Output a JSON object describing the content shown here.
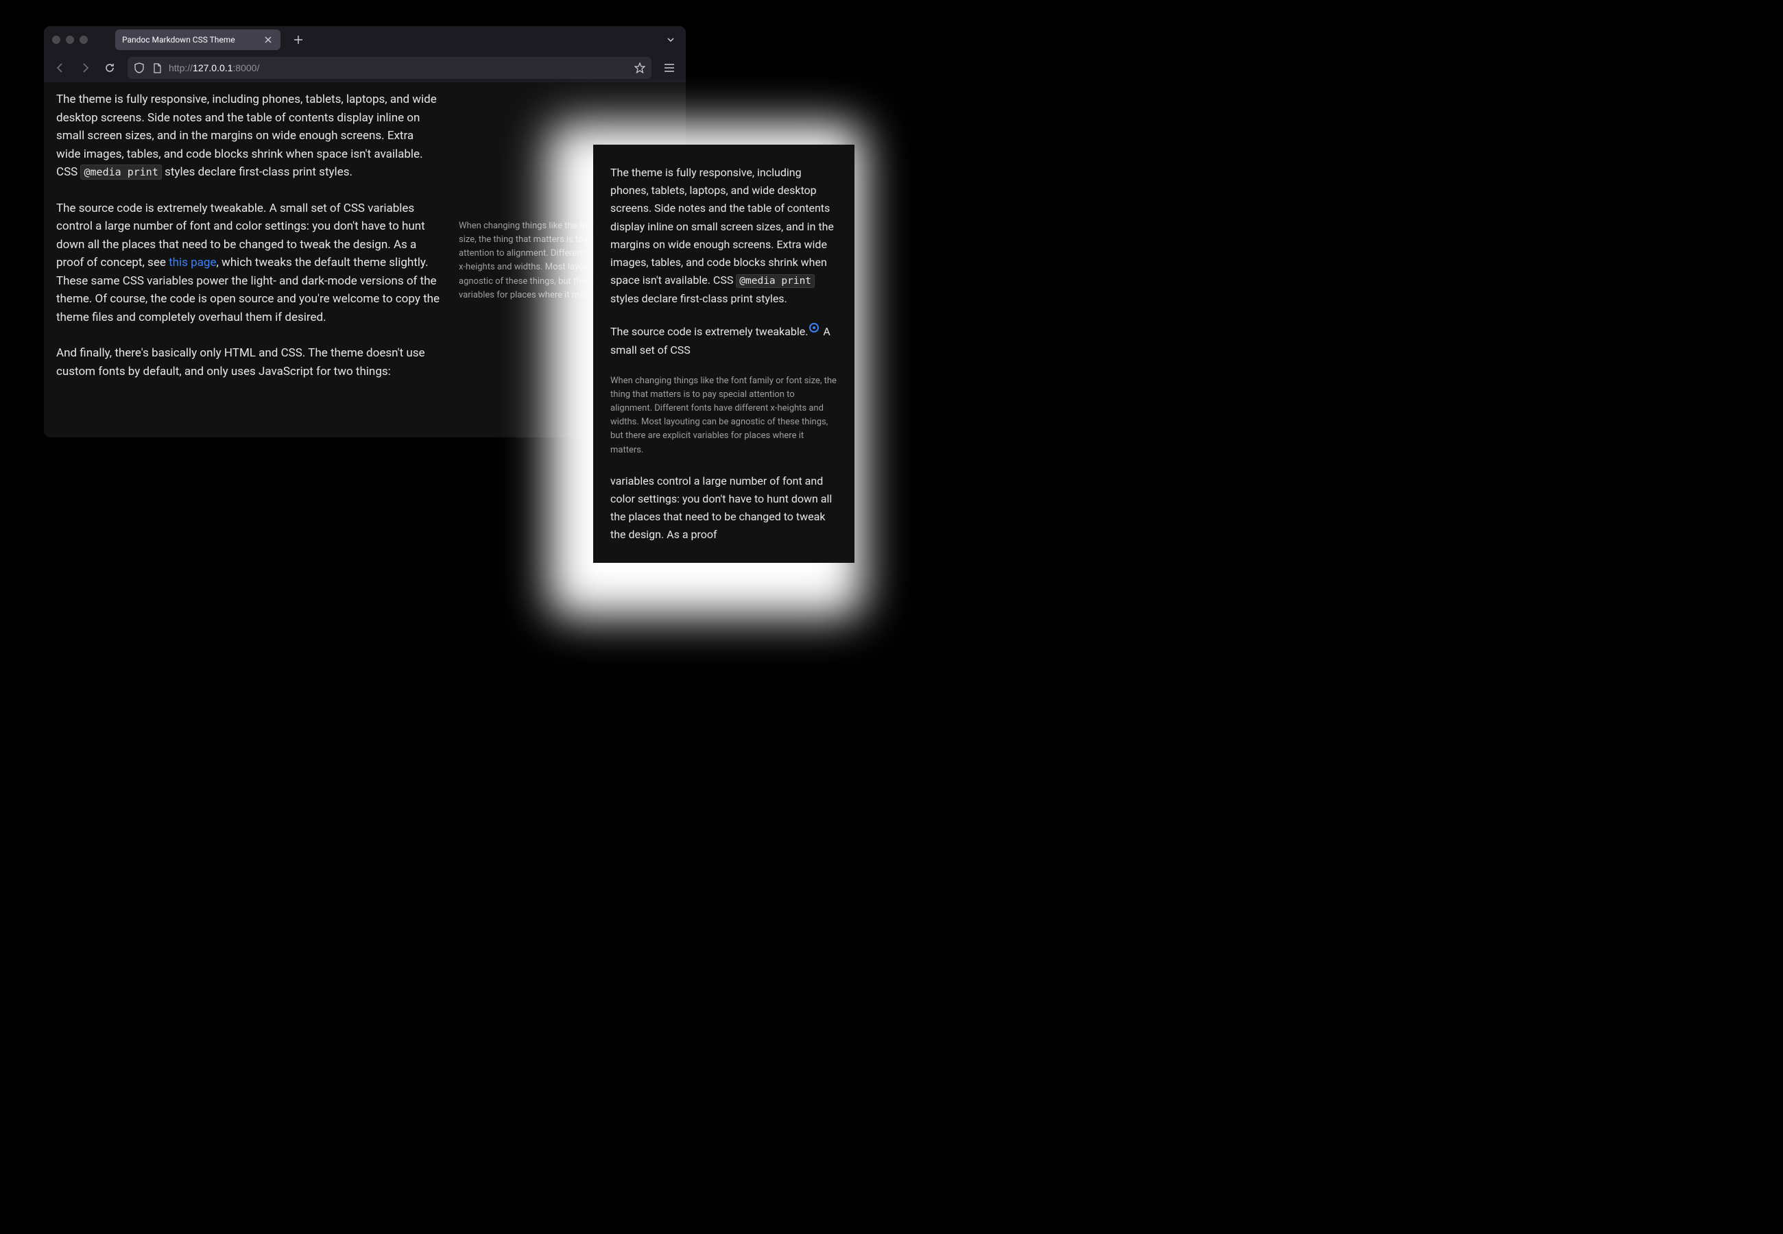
{
  "browser": {
    "tab_title": "Pandoc Markdown CSS Theme",
    "url_prefix": "http://",
    "url_host": "127.0.0.1",
    "url_port": ":8000/",
    "colors": {
      "window_bg": "#1c1b22",
      "page_bg": "#121212",
      "text": "#e6e6e6",
      "link": "#3b82f6",
      "muted": "#9e9e9e"
    }
  },
  "page": {
    "p1_a": "The theme is fully responsive, including phones, tablets, laptops, and wide desktop screens. Side notes and the table of contents display inline on small screen sizes, and in the margins on wide enough screens. Extra wide images, tables, and code blocks shrink when space isn't available. CSS ",
    "p1_code": "@media print",
    "p1_b": " styles declare first-class print styles.",
    "p2_a": "The source code is extremely tweakable. A small set of CSS variables control a large number of font and color settings: you don't have to hunt down all the places that need to be changed to tweak the design. As a proof of concept, see ",
    "p2_link": "this page",
    "p2_b": ", which tweaks the default theme slightly. These same CSS variables power the light- and dark-mode versions of the theme. Of course, the code is open source and you're welcome to copy the theme files and completely overhaul them if desired.",
    "p3": "And finally, there's basically only HTML and CSS. The theme doesn't use custom fonts by default, and only uses JavaScript for two things:",
    "sidenote_desktop": "When changing things like the font family or font size, the thing that matters is to pay special attention to alignment. Different fonts have different x-heights and widths. Most layouting can be agnostic of these things, but there are explicit variables for places where it matters."
  },
  "mobile": {
    "p1_a": "The theme is fully responsive, including phones, tablets, laptops, and wide desktop screens. Side notes and the table of contents display inline on small screen sizes, and in the margins on wide enough screens. Extra wide images, tables, and code blocks shrink when space isn't available. CSS ",
    "p1_code": "@media print",
    "p1_b": " styles declare first-class print styles.",
    "p2_a": "The source code is extremely tweakable.",
    "p2_b": " A small set of CSS",
    "sidenote": "When changing things like the font family or font size, the thing that matters is to pay special attention to alignment. Different fonts have different x-heights and widths. Most layouting can be agnostic of these things, but there are explicit variables for places where it matters.",
    "p3": "variables control a large number of font and color settings: you don't have to hunt down all the places that need to be changed to tweak the design. As a proof"
  }
}
